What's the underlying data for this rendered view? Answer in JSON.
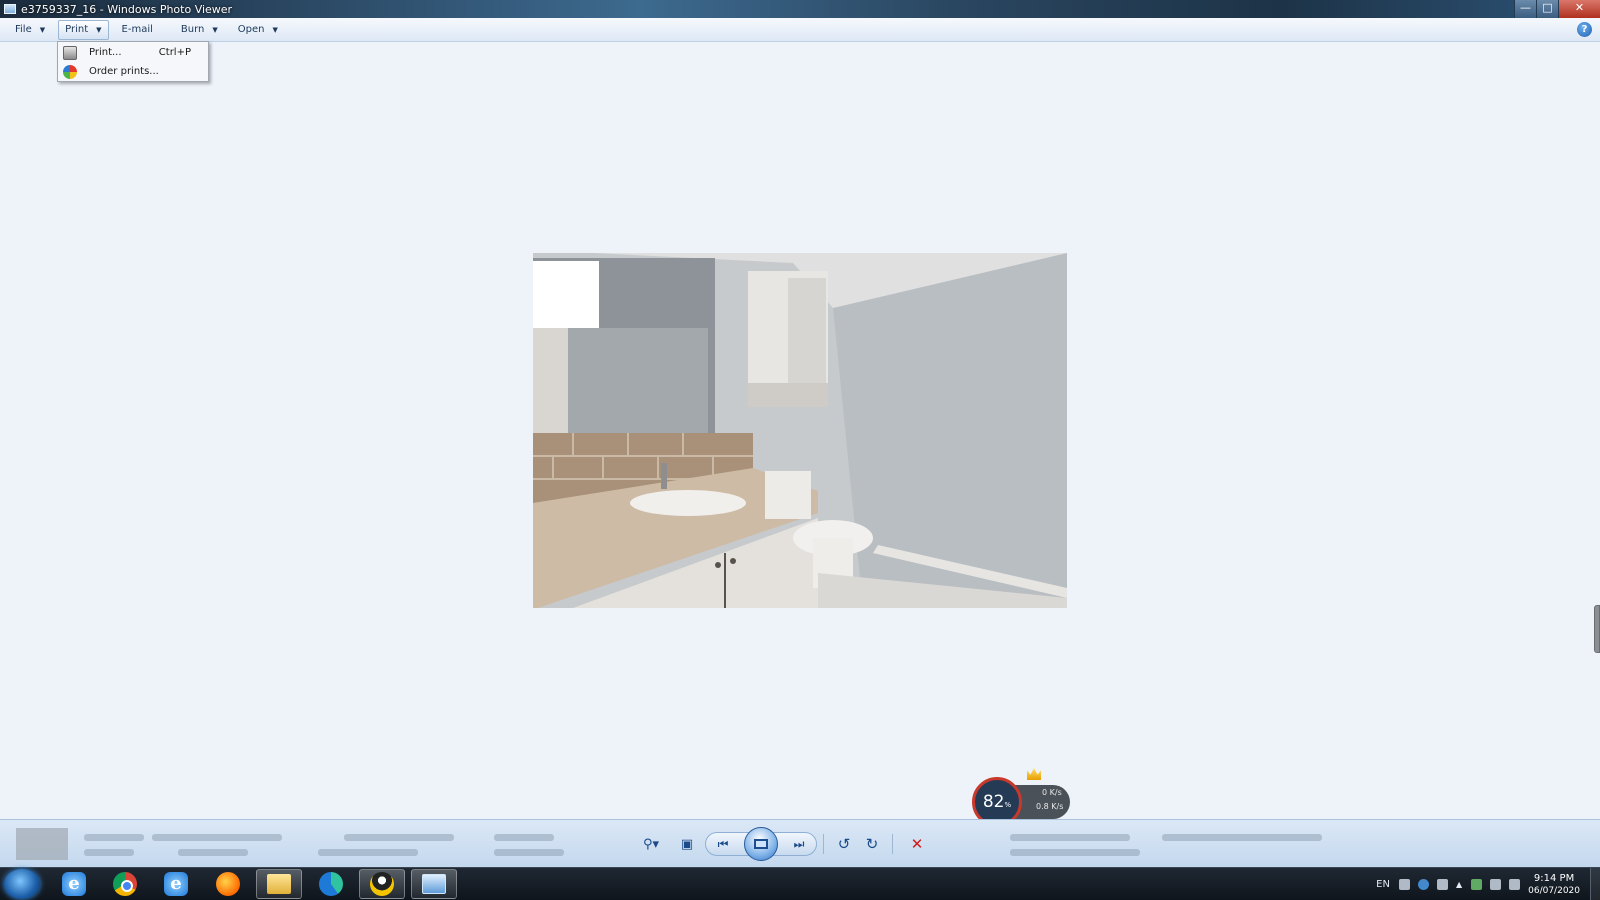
{
  "window": {
    "title": "e3759337_16 - Windows Photo Viewer"
  },
  "menubar": {
    "items": [
      {
        "label": "File",
        "has_arrow": true
      },
      {
        "label": "Print",
        "has_arrow": true,
        "active": true
      },
      {
        "label": "E-mail",
        "has_arrow": false
      },
      {
        "label": "Burn",
        "has_arrow": true
      },
      {
        "label": "Open",
        "has_arrow": true
      }
    ],
    "help_label": "?"
  },
  "print_menu": {
    "items": [
      {
        "label": "Print...",
        "shortcut": "Ctrl+P",
        "icon": "printer-icon"
      },
      {
        "label": "Order prints...",
        "shortcut": "",
        "icon": "globe-icon"
      }
    ]
  },
  "speed_widget": {
    "percent": "82",
    "percent_unit": "%",
    "upload": "0 K/s",
    "download": "0.8 K/s"
  },
  "controls": {
    "zoom_icon": "zoom-icon",
    "fit_icon": "actual-size-icon",
    "prev_icon": "previous-icon",
    "slideshow_icon": "slideshow-icon",
    "next_icon": "next-icon",
    "rotate_ccw_icon": "rotate-counterclockwise-icon",
    "rotate_cw_icon": "rotate-clockwise-icon",
    "delete_icon": "delete-icon"
  },
  "taskbar": {
    "apps": [
      "internet-explorer-icon",
      "chrome-icon",
      "internet-explorer-icon",
      "firefox-icon",
      "file-explorer-icon",
      "edge-icon",
      "qq-icon",
      "photo-viewer-icon"
    ],
    "language": "EN",
    "time": "9:14 PM",
    "date": "06/07/2020"
  },
  "colors": {
    "accent": "#1e395b",
    "speed_ring": "#c8392b",
    "delete": "#d21a1a"
  }
}
